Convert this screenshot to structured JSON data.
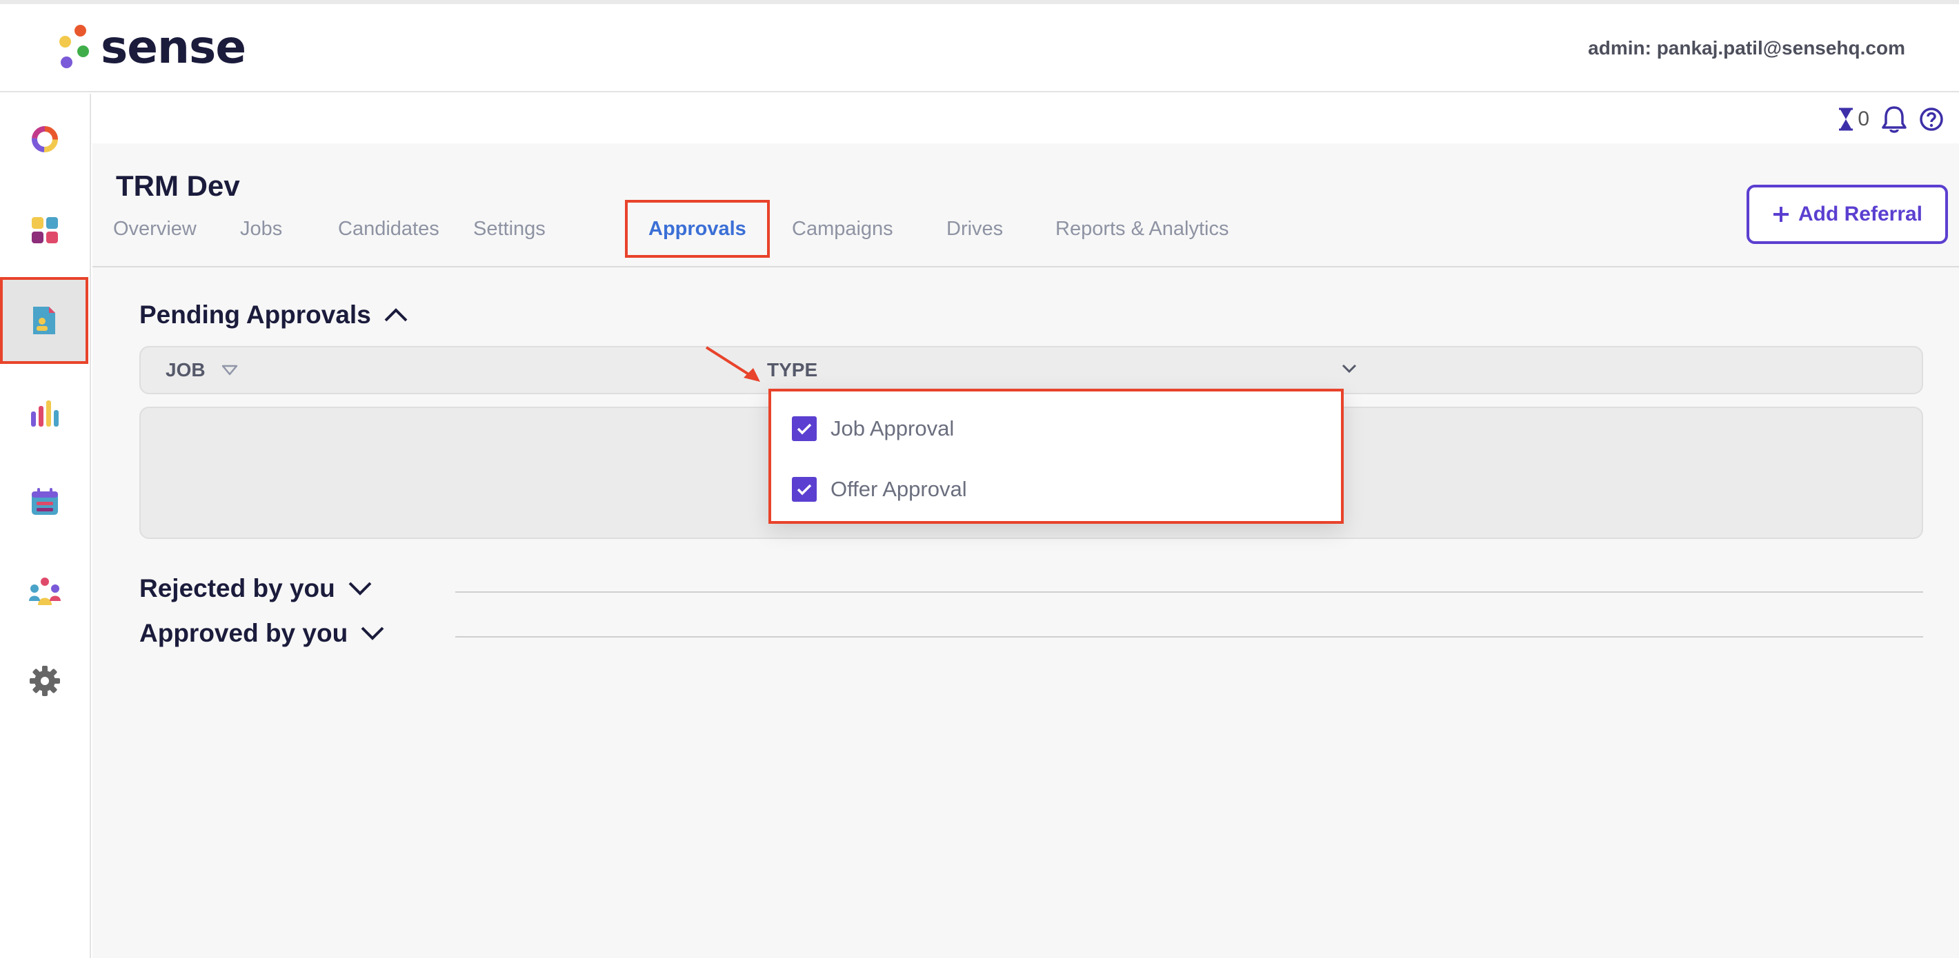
{
  "brand": {
    "name": "sense",
    "dot_colors": [
      "#e9582d",
      "#f2c94c",
      "#3fae49",
      "#7a5ad8"
    ]
  },
  "header": {
    "admin_label": "admin: pankaj.patil@sensehq.com"
  },
  "sidebar": {
    "items": [
      {
        "icon": "donut-chart-icon"
      },
      {
        "icon": "dashboard-grid-icon"
      },
      {
        "icon": "document-user-icon",
        "active": true
      },
      {
        "icon": "bar-chart-icon"
      },
      {
        "icon": "calendar-icon"
      },
      {
        "icon": "people-group-icon"
      },
      {
        "icon": "gear-icon"
      }
    ]
  },
  "toolbar": {
    "counter_value": "0",
    "icons": [
      "hourglass-icon",
      "bell-icon",
      "help-icon"
    ]
  },
  "page": {
    "title": "TRM Dev",
    "tabs": [
      {
        "label": "Overview"
      },
      {
        "label": "Jobs"
      },
      {
        "label": "Candidates"
      },
      {
        "label": "Settings"
      },
      {
        "label": "Approvals",
        "active": true
      },
      {
        "label": "Campaigns"
      },
      {
        "label": "Drives"
      },
      {
        "label": "Reports & Analytics"
      }
    ],
    "add_referral_label": "Add Referral"
  },
  "pending": {
    "title": "Pending Approvals",
    "columns": {
      "job": "JOB",
      "type": "TYPE"
    },
    "type_filter": {
      "options": [
        {
          "label": "Job Approval",
          "checked": true
        },
        {
          "label": "Offer Approval",
          "checked": true
        }
      ]
    }
  },
  "rejected": {
    "title": "Rejected by you"
  },
  "approved": {
    "title": "Approved by you"
  },
  "colors": {
    "accent": "#5b3fd0",
    "highlight": "#e8432b",
    "active_tab": "#3b6fd6"
  }
}
